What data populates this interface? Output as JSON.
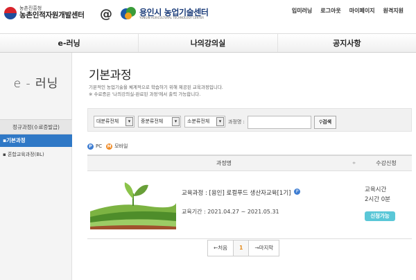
{
  "header": {
    "org_small": "농촌진흥청",
    "org_big": "농촌인적자원개발센터",
    "at": "@",
    "partner_big": "용인시 농업기술센터",
    "partner_small": "YONGIN AGRICULTURAL TECHNOLOGY CENTER",
    "links": [
      "입미러닝",
      "로그아웃",
      "마이페이지",
      "원격지원"
    ]
  },
  "nav": [
    "e-러닝",
    "나의강의실",
    "공지사항"
  ],
  "sidebar": {
    "title": "e - 러닝",
    "group": "정규과정(수료증발급)",
    "active_item": "▪기본과정",
    "item": "▪ 혼합교육과정(BL)"
  },
  "main": {
    "title": "기본과정",
    "desc1": "기본적인 농업기술을 체계적으로 학습하기 위해 제공된 교육과정입니다.",
    "desc2": "※ 수료증은 '나의강의실-완료된 과정'에서 출력 가능합니다."
  },
  "filters": {
    "select1": "대분류전체",
    "select2": "중분류전체",
    "select3": "소분류전체",
    "search_label": "과정명 :",
    "search_value": "",
    "search_button": "검색"
  },
  "legend": {
    "pc_icon": "P",
    "pc_label": "PC",
    "mobile_icon": "M",
    "mobile_label": "모바일"
  },
  "table": {
    "col_course": "과정명",
    "sort_icon": "≑",
    "col_apply": "수강신청",
    "rows": [
      {
        "course": "교육과정 : [용인] 로컬푸드 생산자교육[1기]",
        "pc_badge": "P",
        "period": "교육기간 : 2021.04.27 ~ 2021.05.31",
        "time_label": "교육시간",
        "time_value": "2시간 0분",
        "apply": "신청가능"
      }
    ]
  },
  "pager": {
    "first": "←처음",
    "current": "1",
    "last": "→마지막"
  },
  "colors": {
    "active_blue": "#2f78c6",
    "apply_cyan": "#5ac7d7",
    "pc_blue": "#3e7dd2",
    "mobile_orange": "#f08c28"
  }
}
